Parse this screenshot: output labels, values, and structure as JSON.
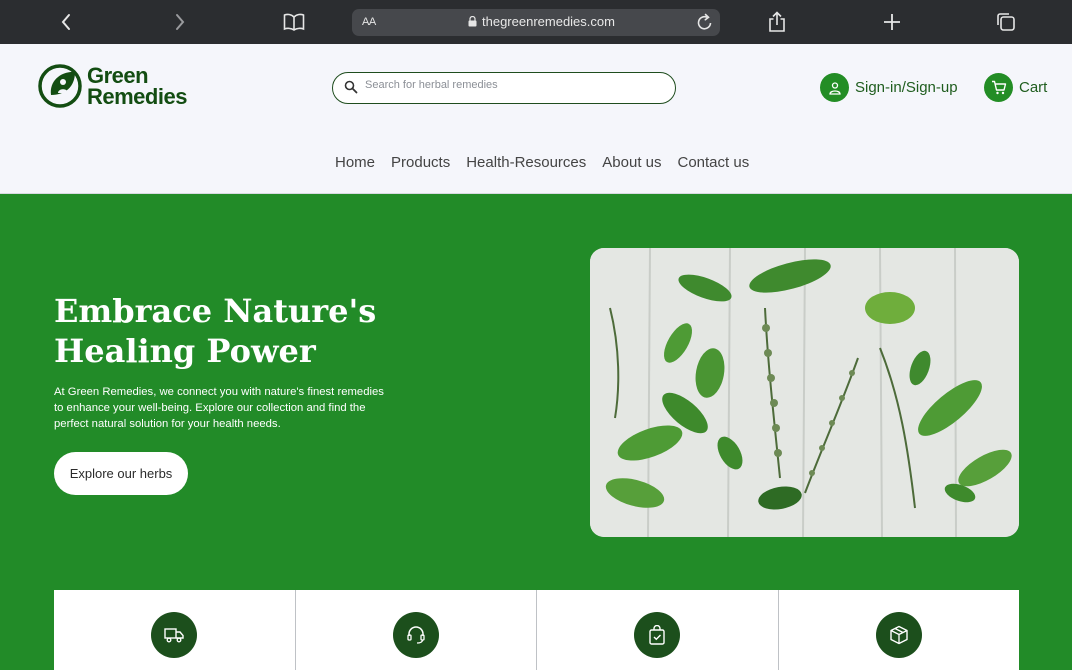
{
  "browser": {
    "url": "thegreenremedies.com",
    "aa_label": "AA"
  },
  "header": {
    "logo_line1": "Green",
    "logo_line2": "Remedies",
    "search_placeholder": "Search for herbal remedies",
    "signin_label": "Sign-in/Sign-up",
    "cart_label": "Cart"
  },
  "nav": {
    "items": [
      "Home",
      "Products",
      "Health-Resources",
      "About us",
      "Contact us"
    ]
  },
  "hero": {
    "title_line1": "Embrace Nature's",
    "title_line2": "Healing Power",
    "description": "At Green Remedies, we connect you with nature's finest remedies to enhance your well-being. Explore our collection and find the perfect natural solution for your health needs.",
    "button_label": "Explore our herbs"
  },
  "features": {
    "icons": [
      "delivery-truck-icon",
      "headset-support-icon",
      "secure-bag-icon",
      "package-box-icon"
    ]
  },
  "colors": {
    "hero_green": "#228b28",
    "logo_green": "#134d12",
    "dark_green": "#1c4f1c",
    "accent_green": "#238d25"
  }
}
